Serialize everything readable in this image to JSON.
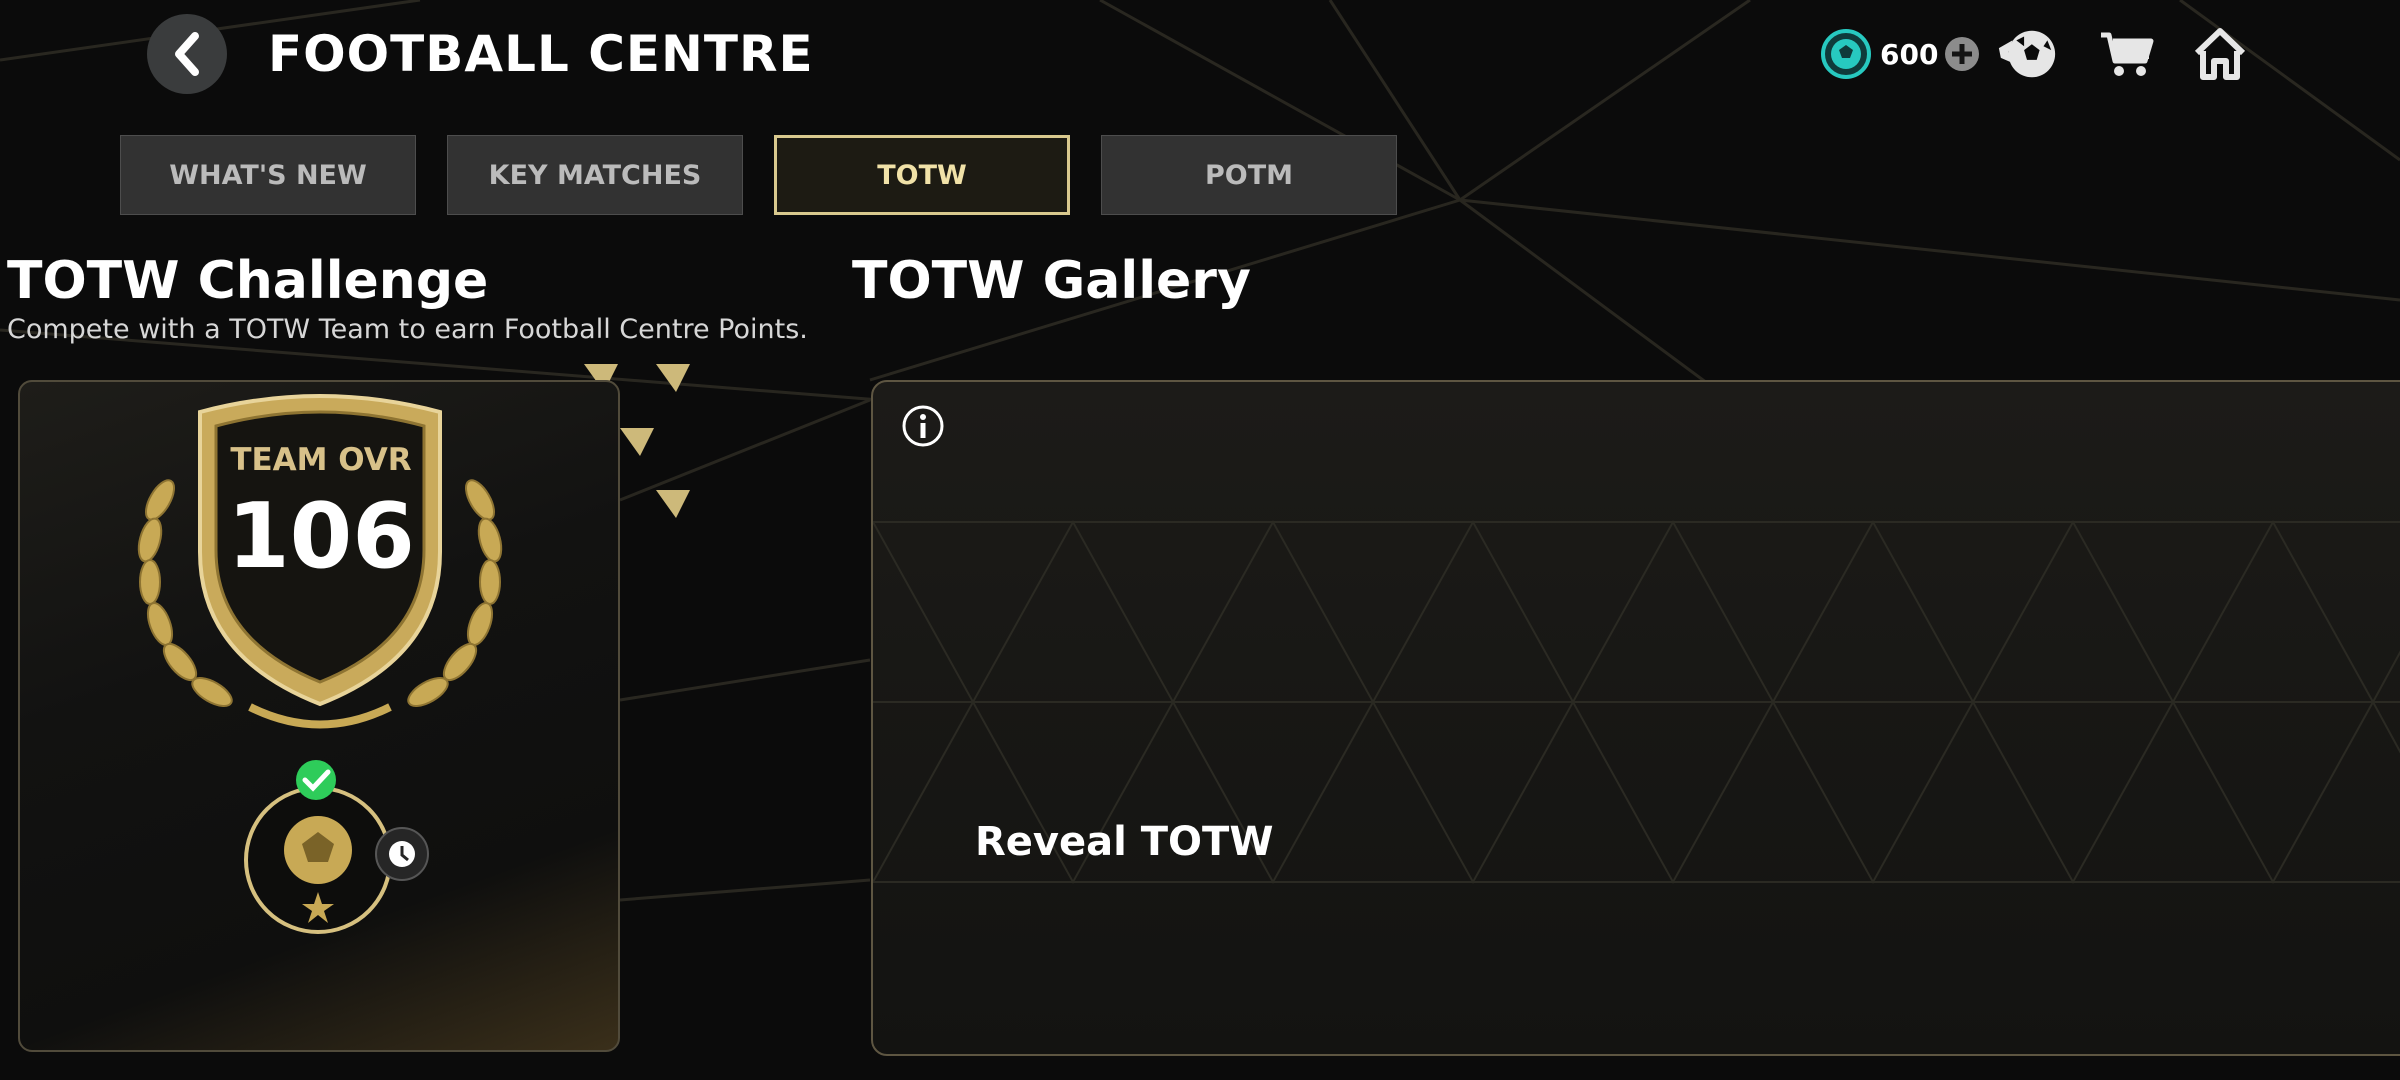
{
  "header": {
    "title": "FOOTBALL CENTRE",
    "coins": "600"
  },
  "tabs": [
    {
      "label": "WHAT'S NEW",
      "active": false
    },
    {
      "label": "KEY MATCHES",
      "active": false
    },
    {
      "label": "TOTW",
      "active": true
    },
    {
      "label": "POTM",
      "active": false
    }
  ],
  "challenge": {
    "title": "TOTW Challenge",
    "subtitle": "Compete with a TOTW Team to earn Football Centre Points.",
    "team_ovr_label": "TEAM OVR",
    "team_ovr_value": "106"
  },
  "gallery": {
    "title": "TOTW Gallery",
    "reveal_label": "Reveal TOTW"
  },
  "icons": {
    "coin": "football-coin-icon",
    "add": "plus-circle-icon",
    "packs": "ball-packs-icon",
    "store": "cart-icon",
    "home": "home-icon",
    "info": "info-icon",
    "completed": "checkmark-icon",
    "timer": "clock-icon"
  },
  "colors": {
    "accent_gold": "#d9c98e",
    "coin_teal": "#27c9c0",
    "check_green": "#2ecc5a"
  }
}
